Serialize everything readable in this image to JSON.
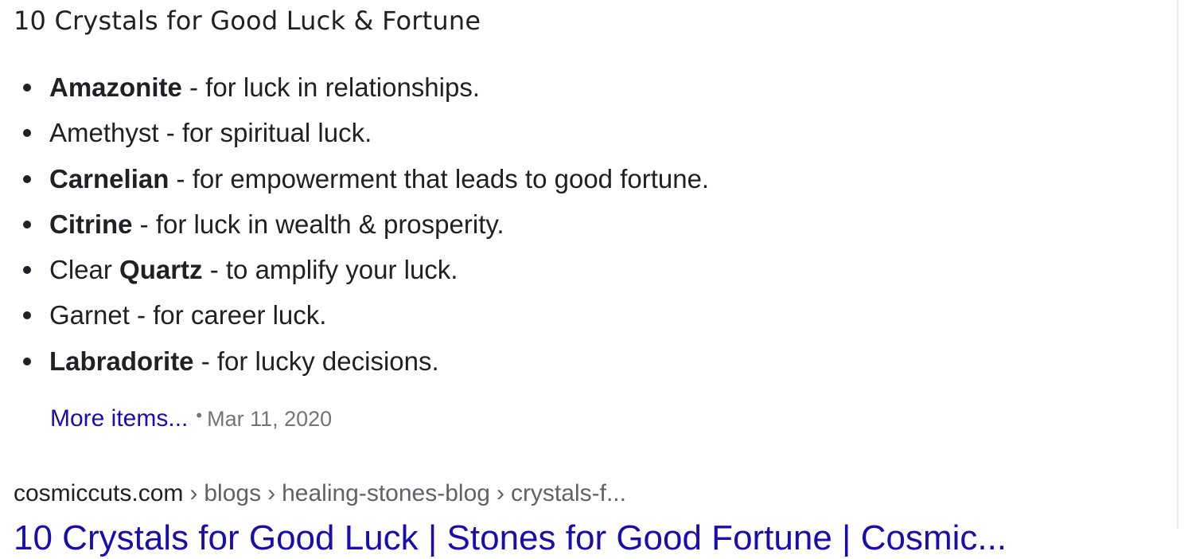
{
  "snippet": {
    "title": "10 Crystals for Good Luck & Fortune",
    "items": [
      {
        "pre": "",
        "bold": "Amazonite",
        "post": " - for luck in relationships."
      },
      {
        "pre": "Amethyst - for spiritual luck.",
        "bold": "",
        "post": ""
      },
      {
        "pre": "",
        "bold": "Carnelian",
        "post": " - for empowerment that leads to good fortune."
      },
      {
        "pre": "",
        "bold": "Citrine",
        "post": " - for luck in wealth & prosperity."
      },
      {
        "pre": "Clear ",
        "bold": "Quartz",
        "post": " - to amplify your luck."
      },
      {
        "pre": "Garnet - for career luck.",
        "bold": "",
        "post": ""
      },
      {
        "pre": "",
        "bold": "Labradorite",
        "post": " - for lucky decisions."
      }
    ],
    "more_items_label": "More items...",
    "separator": "•",
    "date": "Mar 11, 2020"
  },
  "next_result": {
    "breadcrumb": {
      "domain": "cosmiccuts.com",
      "separator": "›",
      "parts": [
        "blogs",
        "healing-stones-blog",
        "crystals-f..."
      ]
    },
    "title": "10 Crystals for Good Luck | Stones for Good Fortune | Cosmic..."
  },
  "colors": {
    "link": "#1a0dab",
    "text": "#202124",
    "muted": "#70757a"
  }
}
